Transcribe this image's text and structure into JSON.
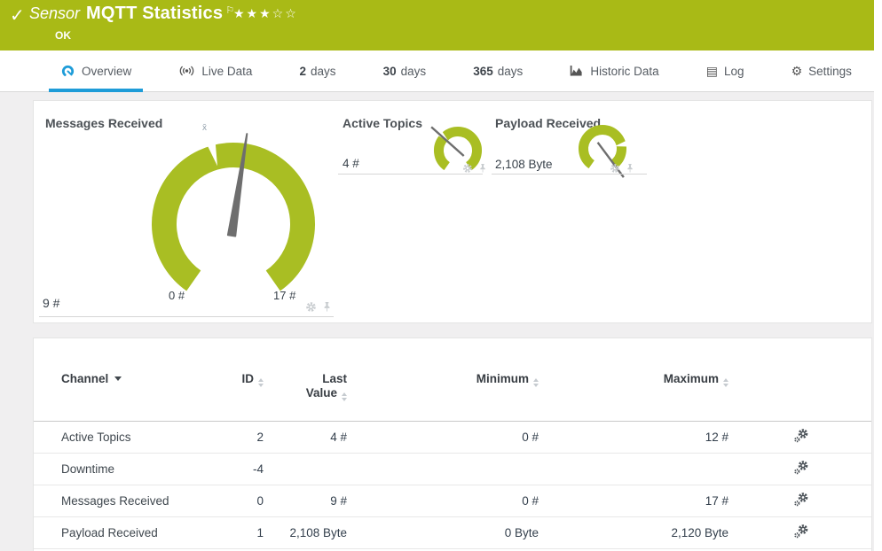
{
  "colors": {
    "header_green": "#a9ba16",
    "gauge_green": "#a9be23",
    "active_tab_blue": "#1e9cd8",
    "needle_gray": "#6e6e6e"
  },
  "header": {
    "check_icon": "✓",
    "kind_label": "Sensor",
    "title": "MQTT Statistics",
    "flag_icon": "⚐",
    "stars": "★★★☆☆",
    "status": "OK"
  },
  "tabs": [
    {
      "label": "Overview"
    },
    {
      "label": "Live Data"
    },
    {
      "prefix": "2",
      "label": "days"
    },
    {
      "prefix": "30",
      "label": "days"
    },
    {
      "prefix": "365",
      "label": "days"
    },
    {
      "label": "Historic Data"
    },
    {
      "label": "Log"
    },
    {
      "label": "Settings"
    }
  ],
  "chart_data": [
    {
      "type": "gauge",
      "title": "Messages Received",
      "unit": "#",
      "min": 0,
      "max": 17,
      "value": 9,
      "average": 7.6,
      "value_label": "9 #",
      "min_label": "0 #",
      "max_label": "17 #",
      "average_marker_label": "x̄"
    },
    {
      "type": "gauge",
      "title": "Active Topics",
      "unit": "#",
      "min": 0,
      "max": 12,
      "value": 4,
      "average": 4.1,
      "value_label": "4 #"
    },
    {
      "type": "gauge",
      "title": "Payload Received",
      "unit": "Byte",
      "min": 0,
      "max": 2120,
      "value": 2108,
      "average": 1630,
      "value_label": "2,108 Byte"
    }
  ],
  "table": {
    "columns": [
      {
        "label": "Channel",
        "sort": "active-desc"
      },
      {
        "label": "ID",
        "sort": "both"
      },
      {
        "line1": "Last",
        "line2": "Value",
        "sort": "both"
      },
      {
        "label": "Minimum",
        "sort": "both"
      },
      {
        "label": "Maximum",
        "sort": "both"
      }
    ],
    "rows": [
      {
        "channel": "Active Topics",
        "id": "2",
        "last_value": "4 #",
        "minimum": "0 #",
        "maximum": "12 #"
      },
      {
        "channel": "Downtime",
        "id": "-4",
        "last_value": "",
        "minimum": "",
        "maximum": ""
      },
      {
        "channel": "Messages Received",
        "id": "0",
        "last_value": "9 #",
        "minimum": "0 #",
        "maximum": "17 #"
      },
      {
        "channel": "Payload Received",
        "id": "1",
        "last_value": "2,108 Byte",
        "minimum": "0 Byte",
        "maximum": "2,120 Byte"
      }
    ]
  }
}
